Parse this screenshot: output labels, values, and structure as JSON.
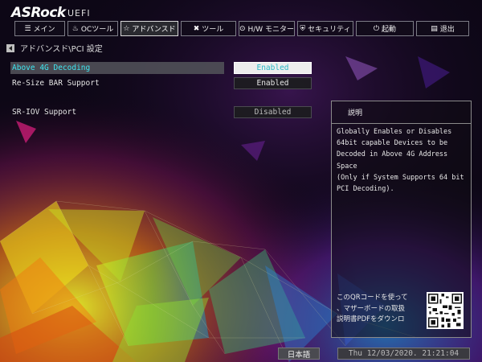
{
  "header": {
    "brand": "ASRock",
    "subtitle": "UEFI"
  },
  "tabs": [
    {
      "label": "メイン",
      "icon": "menu-icon",
      "glyph": "☰"
    },
    {
      "label": "OCツール",
      "icon": "flame-icon",
      "glyph": "♨"
    },
    {
      "label": "アドバンスド",
      "icon": "star-icon",
      "glyph": "☆"
    },
    {
      "label": "ツール",
      "icon": "tools-icon",
      "glyph": "✖"
    },
    {
      "label": "H/W モニター",
      "icon": "monitor-icon",
      "glyph": "⊙"
    },
    {
      "label": "セキュリティ",
      "icon": "shield-icon",
      "glyph": "⛨"
    },
    {
      "label": "起動",
      "icon": "power-icon",
      "glyph": "⏻"
    },
    {
      "label": "退出",
      "icon": "exit-icon",
      "glyph": "▤"
    }
  ],
  "breadcrumb": "アドバンスド\\PCI 設定",
  "settings": [
    {
      "label": "Above 4G Decoding",
      "value": "Enabled"
    },
    {
      "label": "Re-Size BAR Support",
      "value": "Enabled"
    },
    {
      "label": "SR-IOV Support",
      "value": "Disabled"
    }
  ],
  "help": {
    "title": "説明",
    "line1": "Globally Enables or Disables",
    "line2": "64bit capable Devices to be",
    "line3": "Decoded in Above 4G Address Space",
    "line4": "(Only if System Supports 64 bit",
    "line5": "PCI Decoding).",
    "qr_line1": "このQRコードを使って",
    "qr_line2": "、マザーボードの取扱",
    "qr_line3": "説明書PDFをダウンロ"
  },
  "footer": {
    "language": "日本語",
    "datetime": "Thu 12/03/2020. 21:21:04"
  },
  "colors": {
    "highlight": "#3ee6f0",
    "background": "#0d0716"
  }
}
